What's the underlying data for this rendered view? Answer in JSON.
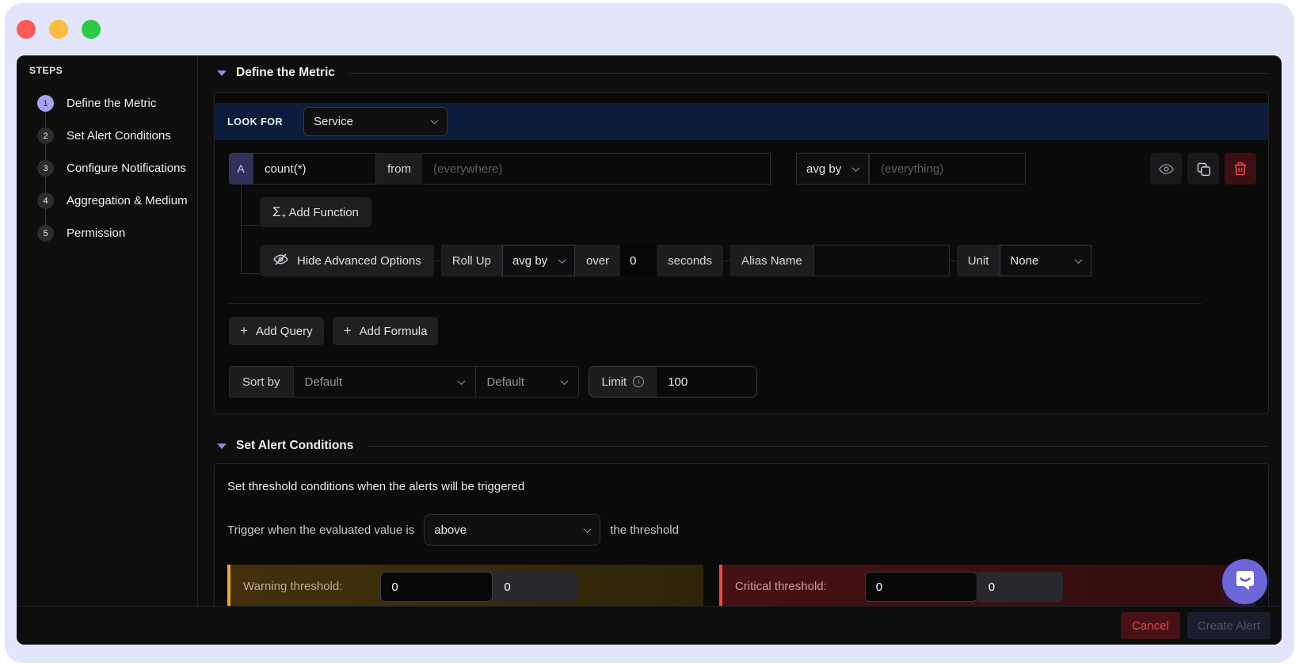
{
  "sidebar": {
    "title": "STEPS",
    "steps": [
      {
        "num": "1",
        "label": "Define the Metric",
        "active": true
      },
      {
        "num": "2",
        "label": "Set Alert Conditions",
        "active": false
      },
      {
        "num": "3",
        "label": "Configure Notifications",
        "active": false
      },
      {
        "num": "4",
        "label": "Aggregation & Medium",
        "active": false
      },
      {
        "num": "5",
        "label": "Permission",
        "active": false
      }
    ]
  },
  "define_section": {
    "title": "Define the Metric",
    "look_for_label": "LOOK FOR",
    "look_for_value": "Service",
    "query": {
      "letter": "A",
      "expression": "count(*)",
      "from_label": "from",
      "from_placeholder": "(everywhere)",
      "agg_op": "avg by",
      "agg_placeholder": "(everything)"
    },
    "add_function_label": "Add Function",
    "advanced": {
      "toggle_label": "Hide Advanced Options",
      "rollup_label": "Roll Up",
      "rollup_op": "avg by",
      "over_label": "over",
      "over_value": "0",
      "seconds_label": "seconds",
      "alias_label": "Alias Name",
      "alias_value": "",
      "unit_label": "Unit",
      "unit_value": "None"
    },
    "add_query_label": "Add Query",
    "add_formula_label": "Add Formula",
    "sort": {
      "label": "Sort by",
      "primary": "Default",
      "secondary": "Default",
      "limit_label": "Limit",
      "limit_value": "100"
    }
  },
  "alert_section": {
    "title": "Set Alert Conditions",
    "description": "Set threshold conditions when the alerts will be triggered",
    "trigger_prefix": "Trigger when the evaluated value is",
    "trigger_operator": "above",
    "trigger_suffix": "the threshold",
    "warning": {
      "label": "Warning threshold:",
      "value": "0",
      "secondary_value": "0"
    },
    "critical": {
      "label": "Critical threshold:",
      "value": "0",
      "secondary_value": "0"
    }
  },
  "footer": {
    "cancel_label": "Cancel",
    "create_label": "Create Alert"
  },
  "colors": {
    "frame_bg": "#e3e6fb",
    "window_bg": "#0e0e0f",
    "accent_purple": "#8f8be8",
    "step_active": "#a6a3ee",
    "look_for_bg": "#0b1c3d",
    "query_badge_bg": "#30315a",
    "warning_border": "#eda73b",
    "critical_border": "#f0474c",
    "danger": "#e5484d",
    "chat_bubble": "#6b67d9",
    "traffic_red": "#fc5b53",
    "traffic_yellow": "#fdbc40",
    "traffic_green": "#2ec944"
  }
}
